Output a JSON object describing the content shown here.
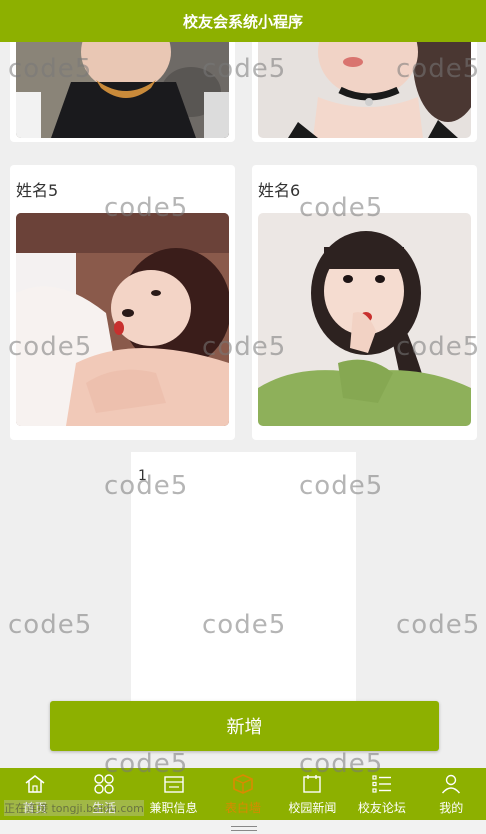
{
  "header": {
    "title": "校友会系统小程序"
  },
  "cards": [
    {
      "name": "姓名5"
    },
    {
      "name": "姓名6"
    }
  ],
  "pager": {
    "page": "1"
  },
  "add_button": {
    "label": "新增"
  },
  "tabbar": {
    "active_color": "#d98a00",
    "items": [
      {
        "label": "首页",
        "icon": "home-icon"
      },
      {
        "label": "生活",
        "icon": "grid-icon"
      },
      {
        "label": "兼职信息",
        "icon": "briefcase-icon"
      },
      {
        "label": "表白墙",
        "icon": "box-icon"
      },
      {
        "label": "校园新闻",
        "icon": "calendar-icon"
      },
      {
        "label": "校友论坛",
        "icon": "list-icon"
      },
      {
        "label": "我的",
        "icon": "user-icon"
      }
    ]
  },
  "watermark": {
    "text": "code5"
  },
  "status_overlay": {
    "text": "正在连接 tongji.baidu.com"
  },
  "colors": {
    "brand": "#8db000",
    "background": "#efefef"
  }
}
